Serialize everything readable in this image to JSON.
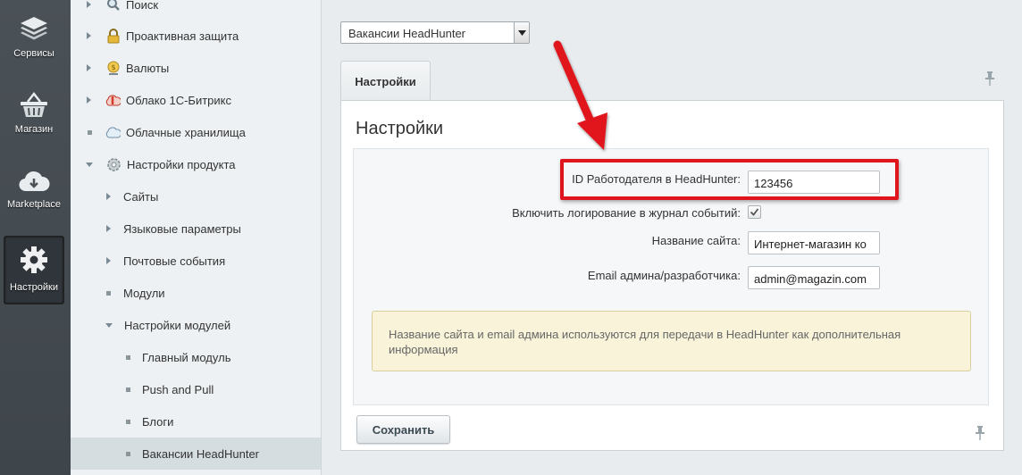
{
  "sidebar": {
    "items": [
      {
        "label": "Сервисы",
        "icon": "layers-icon"
      },
      {
        "label": "Магазин",
        "icon": "basket-icon"
      },
      {
        "label": "Marketplace",
        "icon": "cloud-download-icon"
      },
      {
        "label": "Настройки",
        "icon": "gear-icon",
        "active": true
      }
    ]
  },
  "tree": {
    "items": [
      {
        "label": "Поиск"
      },
      {
        "label": "Проактивная защита"
      },
      {
        "label": "Валюты"
      },
      {
        "label": "Облако 1С-Битрикс"
      },
      {
        "label": "Облачные хранилища"
      },
      {
        "label": "Настройки продукта"
      },
      {
        "label": "Сайты"
      },
      {
        "label": "Языковые параметры"
      },
      {
        "label": "Почтовые события"
      },
      {
        "label": "Модули"
      },
      {
        "label": "Настройки модулей"
      },
      {
        "label": "Главный модуль"
      },
      {
        "label": "Push and Pull"
      },
      {
        "label": "Блоги"
      },
      {
        "label": "Вакансии HeadHunter"
      }
    ]
  },
  "main": {
    "module_select": "Вакансии HeadHunter",
    "tab": "Настройки",
    "title": "Настройки",
    "fields": {
      "employer_id_label": "ID Работодателя в HeadHunter:",
      "employer_id_value": "123456",
      "logging_label": "Включить логирование в журнал событий:",
      "logging_checked": true,
      "site_name_label": "Название сайта:",
      "site_name_value": "Интернет-магазин ко",
      "email_label": "Email админа/разработчика:",
      "email_value": "admin@magazin.com"
    },
    "note": "Название сайта и email админа используются для передачи в HeadHunter как дополнительная информация",
    "save_label": "Сохранить"
  },
  "colors": {
    "annotation_red": "#e0141c",
    "sidebar_bg": "#434a50",
    "note_bg": "#f9f4d9"
  }
}
